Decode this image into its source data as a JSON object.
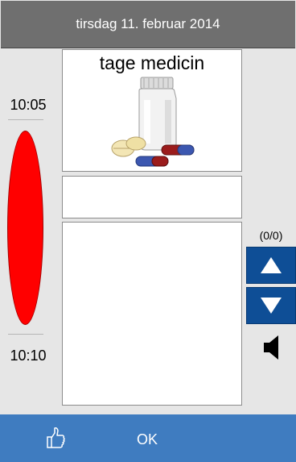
{
  "header": {
    "date": "tirsdag 11. februar 2014"
  },
  "timeline": {
    "start_time": "10:05",
    "end_time": "10:10",
    "indicator_color": "#ff0000"
  },
  "activity": {
    "title": "tage medicin",
    "image_icon": "medicine-pills-icon"
  },
  "navigation": {
    "counter": "(0/0)",
    "up_icon": "arrow-up-icon",
    "down_icon": "arrow-down-icon",
    "sound_icon": "speaker-icon"
  },
  "footer": {
    "ok_label": "OK",
    "thumb_icon": "thumbs-up-icon"
  },
  "colors": {
    "header_bg": "#6f6f6f",
    "accent": "#0e4e96",
    "footer_bg": "#3f7cc0"
  }
}
